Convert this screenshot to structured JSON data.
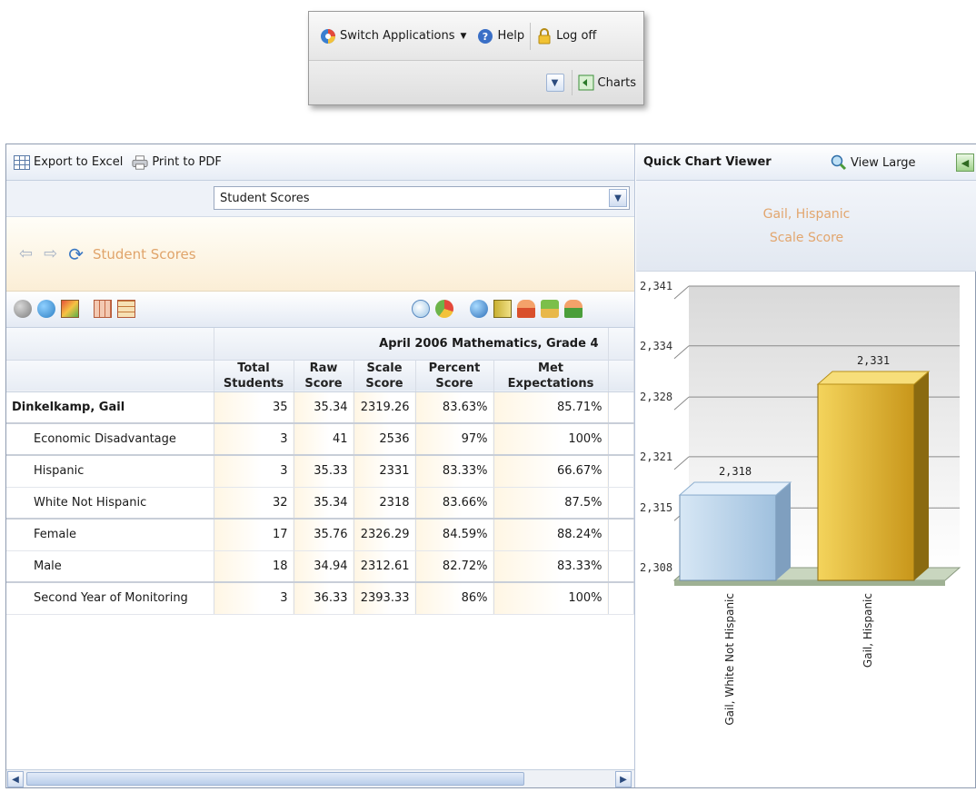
{
  "topbar": {
    "switch_label": "Switch Applications",
    "help_label": "Help",
    "logoff_label": "Log off",
    "charts_label": "Charts"
  },
  "left_toolbar": {
    "export_label": "Export to Excel",
    "print_label": "Print to PDF"
  },
  "report_select": {
    "value": "Student Scores"
  },
  "breadcrumb": "Student Scores",
  "table": {
    "period_header": "April 2006 Mathematics, Grade 4",
    "columns": [
      {
        "l1": "Total",
        "l2": "Students"
      },
      {
        "l1": "Raw",
        "l2": "Score"
      },
      {
        "l1": "Scale",
        "l2": "Score"
      },
      {
        "l1": "Percent",
        "l2": "Score"
      },
      {
        "l1": "Met",
        "l2": "Expectations"
      }
    ],
    "rows": [
      {
        "label": "Dinkelkamp, Gail",
        "total": "35",
        "raw": "35.34",
        "scale": "2319.26",
        "percent": "83.63%",
        "met": "85.71%"
      },
      {
        "label": "Economic Disadvantage",
        "total": "3",
        "raw": "41",
        "scale": "2536",
        "percent": "97%",
        "met": "100%"
      },
      {
        "label": "Hispanic",
        "total": "3",
        "raw": "35.33",
        "scale": "2331",
        "percent": "83.33%",
        "met": "66.67%"
      },
      {
        "label": "White Not Hispanic",
        "total": "32",
        "raw": "35.34",
        "scale": "2318",
        "percent": "83.66%",
        "met": "87.5%"
      },
      {
        "label": "Female",
        "total": "17",
        "raw": "35.76",
        "scale": "2326.29",
        "percent": "84.59%",
        "met": "88.24%"
      },
      {
        "label": "Male",
        "total": "18",
        "raw": "34.94",
        "scale": "2312.61",
        "percent": "82.72%",
        "met": "83.33%"
      },
      {
        "label": "Second Year of Monitoring",
        "total": "3",
        "raw": "36.33",
        "scale": "2393.33",
        "percent": "86%",
        "met": "100%"
      }
    ]
  },
  "quick_chart": {
    "title": "Quick Chart Viewer",
    "view_large_label": "View Large"
  },
  "chart_data": {
    "type": "bar",
    "title": "Gail, Hispanic",
    "subtitle": "Scale Score",
    "categories": [
      "Gail, White Not Hispanic",
      "Gail, Hispanic"
    ],
    "values": [
      2318,
      2331
    ],
    "value_labels": [
      "2,318",
      "2,331"
    ],
    "ylim": [
      2308,
      2341
    ],
    "yticks": [
      "2,341",
      "2,334",
      "2,328",
      "2,321",
      "2,315",
      "2,308"
    ],
    "ytick_values": [
      2341,
      2334,
      2328,
      2321,
      2315,
      2308
    ],
    "grid": true,
    "colors": [
      "#b9d3ea",
      "#d7aa2c"
    ]
  }
}
